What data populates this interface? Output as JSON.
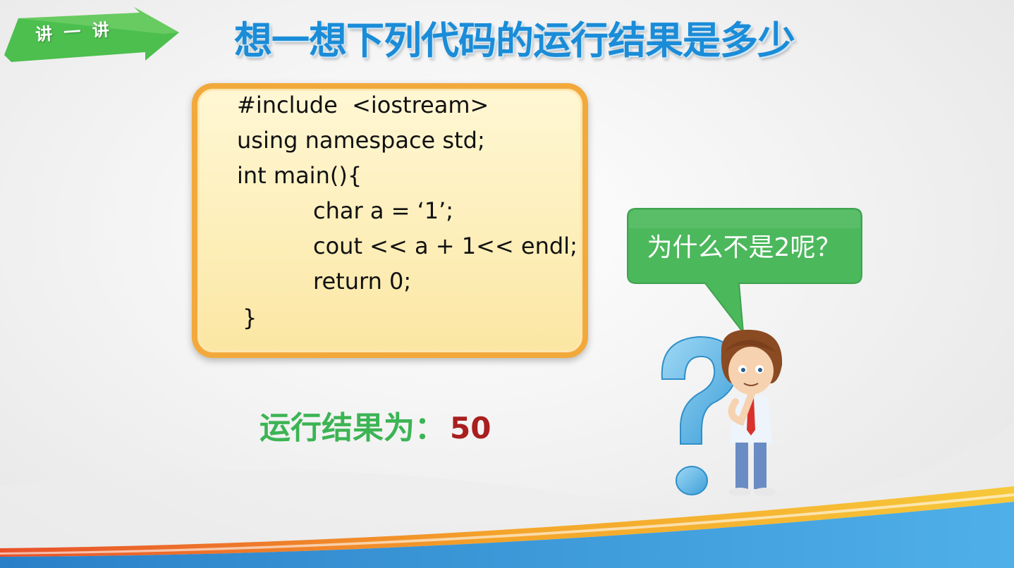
{
  "badge": {
    "label": "讲 一 讲"
  },
  "title": "想一想下列代码的运行结果是多少",
  "code": {
    "lines": [
      "#include  <iostream>",
      "using namespace std;",
      "int main(){",
      "char a = ‘1’;",
      "cout << a + 1<< endl;",
      "return 0;",
      "}"
    ]
  },
  "result": {
    "label": "运行结果为：",
    "value": "50"
  },
  "bubble": {
    "text": "为什么不是2呢？"
  },
  "colors": {
    "title_blue": "#1a8cd8",
    "badge_green": "#4cbf4f",
    "result_green": "#3cb454",
    "result_red": "#a91f1f",
    "code_border": "#f2a93b",
    "bubble_green": "#4cb85c"
  },
  "icons": {
    "figure": "question-mark-thinking-boy-icon"
  }
}
